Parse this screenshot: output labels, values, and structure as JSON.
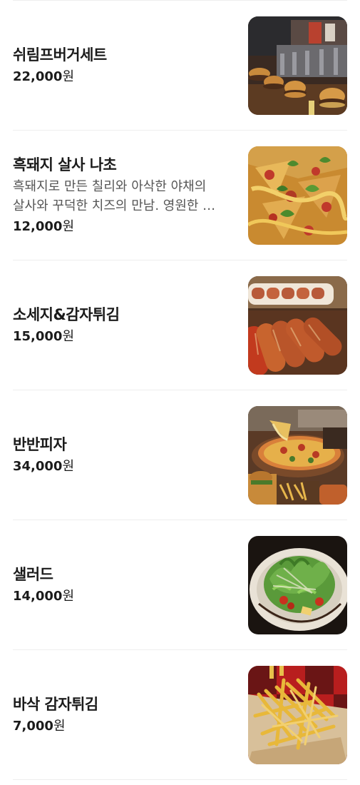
{
  "menu": {
    "items": [
      {
        "name": "쉬림프버거세트",
        "description_lines": [],
        "price": "22,000",
        "currency": "원",
        "image": "shrimp-burger-photo"
      },
      {
        "name": "흑돼지 살사 나초",
        "description_lines": [
          "흑돼지로 만든 칠리와 아삭한 야채의",
          "살사와 꾸덕한 치즈의 만남. 영원한 …"
        ],
        "price": "12,000",
        "currency": "원",
        "image": "nacho-photo"
      },
      {
        "name": "소세지&감자튀김",
        "description_lines": [],
        "price": "15,000",
        "currency": "원",
        "image": "sausage-photo"
      },
      {
        "name": "반반피자",
        "description_lines": [],
        "price": "34,000",
        "currency": "원",
        "image": "pizza-photo"
      },
      {
        "name": "샐러드",
        "description_lines": [],
        "price": "14,000",
        "currency": "원",
        "image": "salad-photo"
      },
      {
        "name": "바삭 감자튀김",
        "description_lines": [],
        "price": "7,000",
        "currency": "원",
        "image": "fries-photo"
      }
    ]
  }
}
